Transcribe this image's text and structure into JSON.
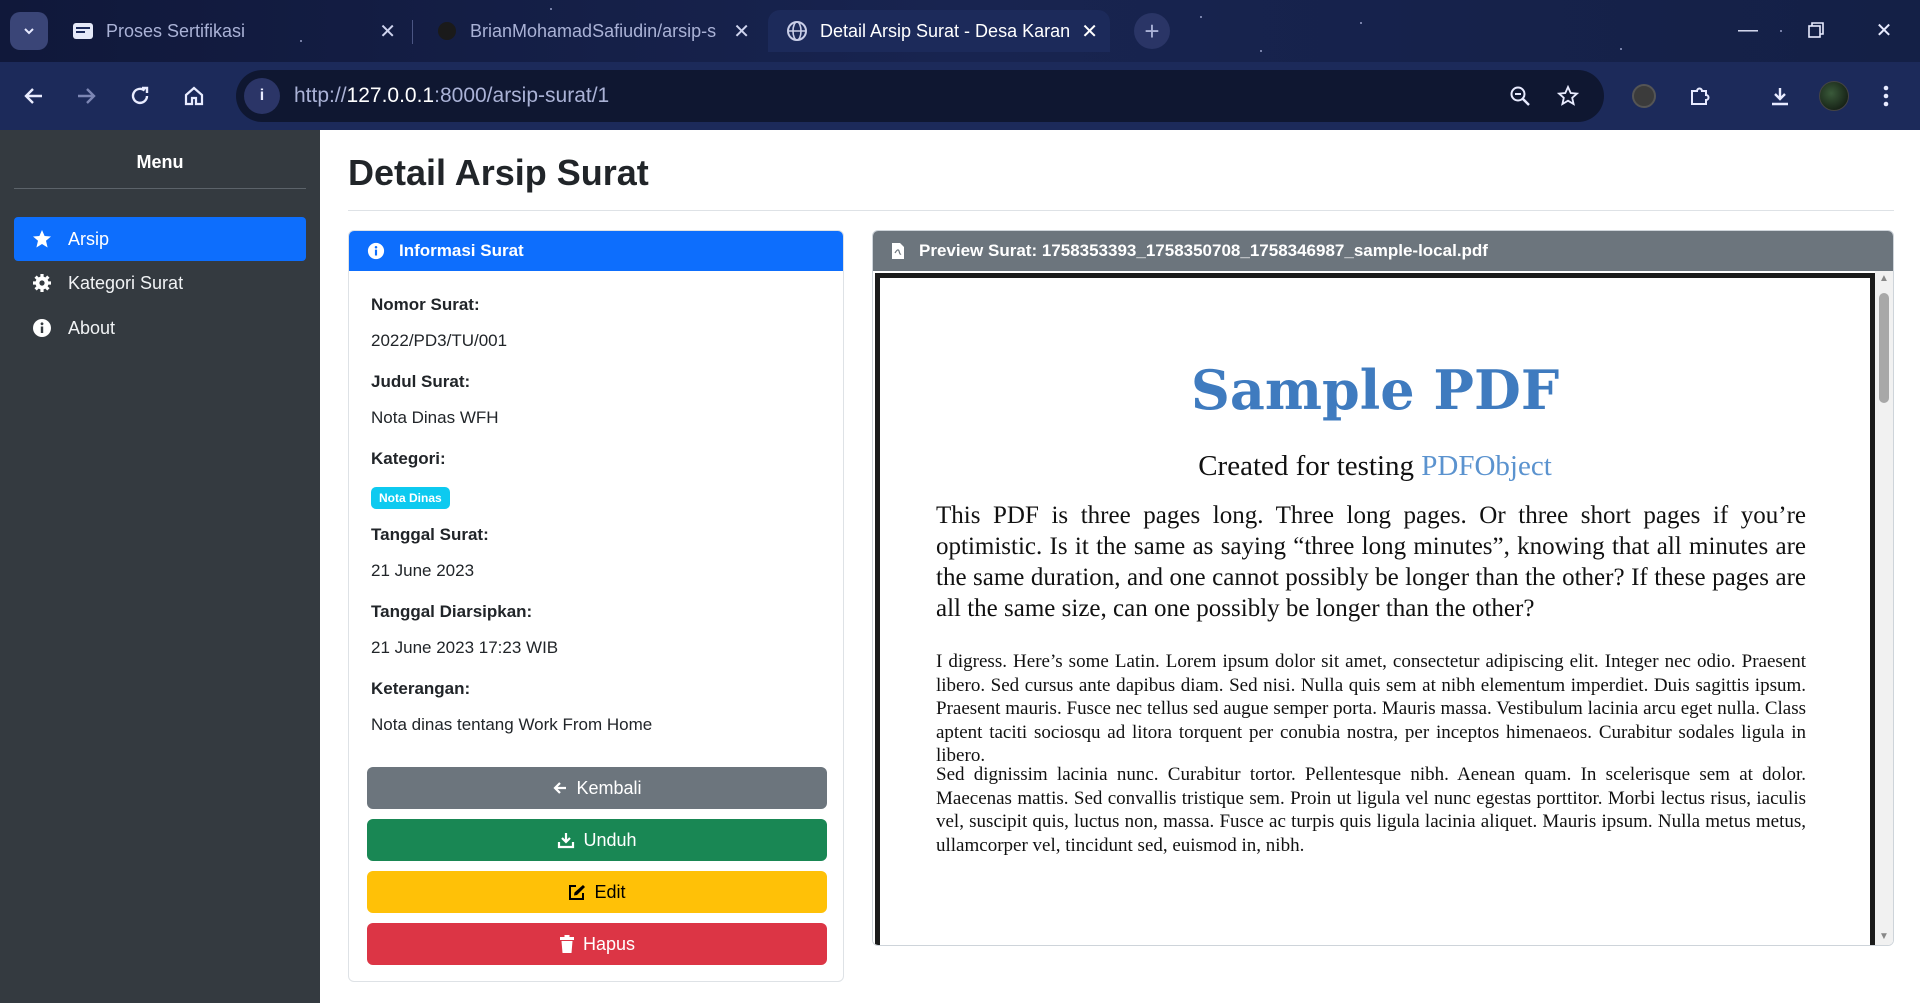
{
  "browser": {
    "tabs": [
      {
        "title": "Proses Sertifikasi",
        "active": false
      },
      {
        "title": "BrianMohamadSafiudin/arsip-s",
        "active": false
      },
      {
        "title": "Detail Arsip Surat - Desa Karang",
        "active": true
      }
    ],
    "url_scheme": "http://",
    "url_host": "127.0.0.1",
    "url_path": ":8000/arsip-surat/1"
  },
  "sidebar": {
    "title": "Menu",
    "items": [
      {
        "label": "Arsip",
        "icon": "star-icon",
        "active": true
      },
      {
        "label": "Kategori Surat",
        "icon": "gear-icon",
        "active": false
      },
      {
        "label": "About",
        "icon": "info-icon",
        "active": false
      }
    ]
  },
  "main": {
    "title": "Detail Arsip Surat",
    "info_card": {
      "header": "Informasi Surat",
      "fields": [
        {
          "label": "Nomor Surat:",
          "value": "2022/PD3/TU/001"
        },
        {
          "label": "Judul Surat:",
          "value": "Nota Dinas WFH"
        },
        {
          "label": "Kategori:",
          "badge": "Nota Dinas"
        },
        {
          "label": "Tanggal Surat:",
          "value": "21 June 2023"
        },
        {
          "label": "Tanggal Diarsipkan:",
          "value": "21 June 2023 17:23 WIB"
        },
        {
          "label": "Keterangan:",
          "value": "Nota dinas tentang Work From Home"
        }
      ],
      "buttons": {
        "back": "Kembali",
        "download": "Unduh",
        "edit": "Edit",
        "delete": "Hapus"
      }
    },
    "preview": {
      "header": "Preview Surat: 1758353393_1758350708_1758346987_sample-local.pdf",
      "pdf": {
        "title": "Sample PDF",
        "subtitle_prefix": "Created for testing ",
        "subtitle_link": "PDFObject",
        "p1": "This PDF is three pages long. Three long pages. Or three short pages if you’re optimistic. Is it the same as saying “three long minutes”, knowing that all minutes are the same duration, and one cannot possibly be longer than the other? If these pages are all the same size, can one possibly be longer than the other?",
        "p2": "I digress. Here’s some Latin. Lorem ipsum dolor sit amet, consectetur adipiscing elit. Integer nec odio. Praesent libero. Sed cursus ante dapibus diam. Sed nisi. Nulla quis sem at nibh elementum imperdiet. Duis sagittis ipsum. Praesent mauris. Fusce nec tellus sed augue semper porta. Mauris massa. Vestibulum lacinia arcu eget nulla. Class aptent taciti sociosqu ad litora torquent per conubia nostra, per inceptos himenaeos. Curabitur sodales ligula in libero.",
        "p3": "Sed dignissim lacinia nunc. Curabitur tortor. Pellentesque nibh. Aenean quam. In scelerisque sem at dolor. Maecenas mattis. Sed convallis tristique sem. Proin ut ligula vel nunc egestas porttitor. Morbi lectus risus, iaculis vel, suscipit quis, luctus non, massa. Fusce ac turpis quis ligula lacinia aliquet. Mauris ipsum. Nulla metus metus, ullamcorper vel, tincidunt sed, euismod in, nibh."
      }
    }
  },
  "colors": {
    "primary": "#0d6efd",
    "secondary": "#6c757d",
    "success": "#198754",
    "warning": "#ffc107",
    "danger": "#dc3545",
    "info": "#0dcaf0",
    "sidebar": "#343a40"
  }
}
